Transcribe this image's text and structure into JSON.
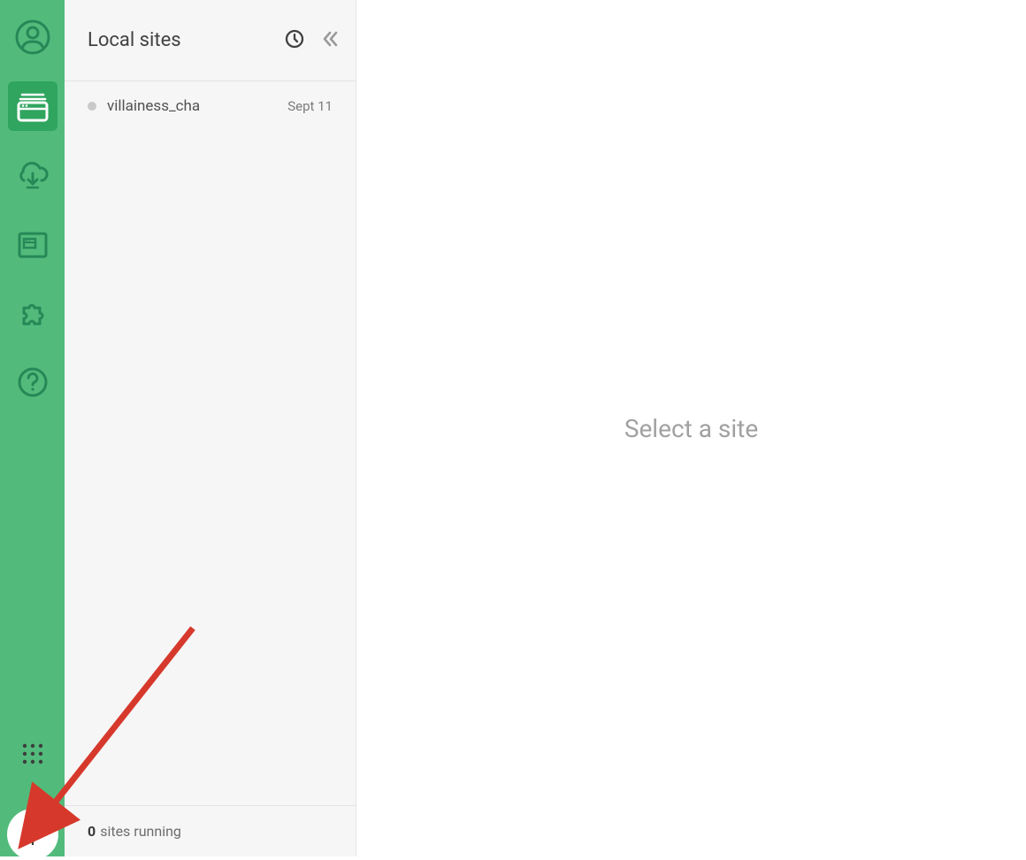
{
  "sidebar": {
    "icons": {
      "profile": "profile-icon",
      "sites": "browser-icon",
      "cloud": "cloud-download-icon",
      "blueprint": "blueprint-icon",
      "addons": "puzzle-icon",
      "help": "help-icon",
      "grid": "grid-icon",
      "add": "plus-icon"
    }
  },
  "panel": {
    "title": "Local sites",
    "sites": [
      {
        "name": "villainess_cha",
        "date": "Sept 11"
      }
    ],
    "footer_count": "0",
    "footer_text": "sites running"
  },
  "main": {
    "empty_state": "Select a site"
  },
  "colors": {
    "rail": "#52bb7b",
    "rail_active": "#2fa55f",
    "panel_bg": "#f6f6f6",
    "arrow": "#d6392c"
  }
}
